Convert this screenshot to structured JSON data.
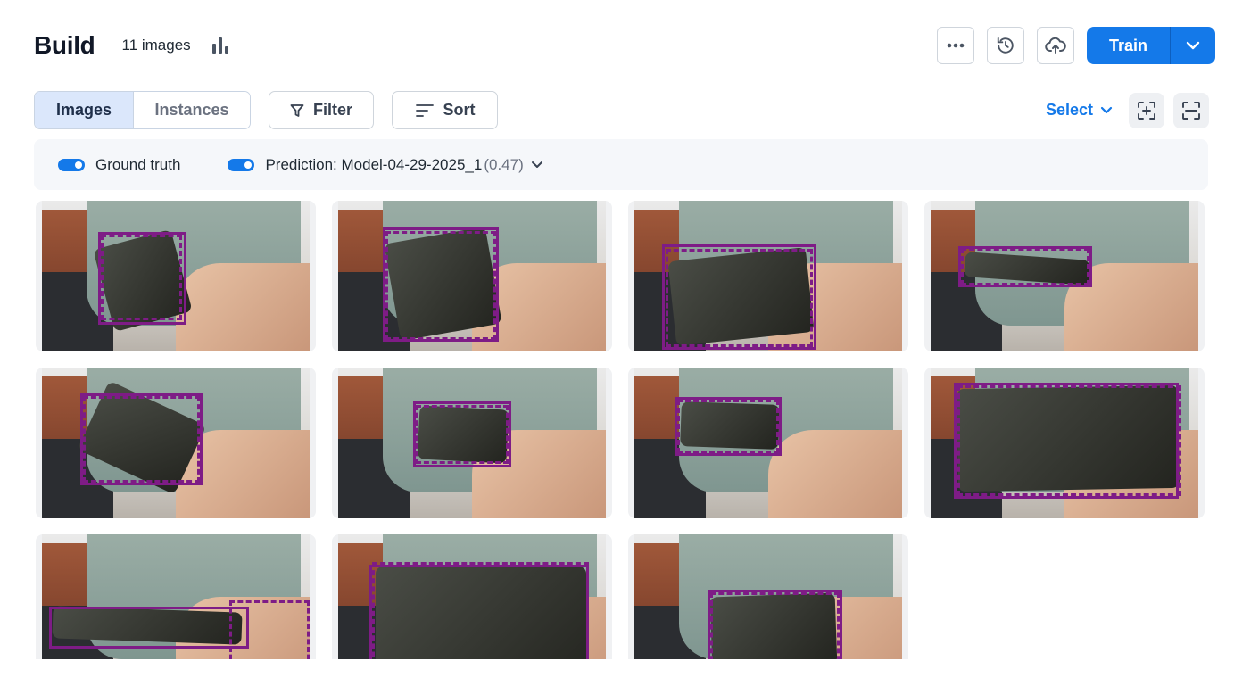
{
  "header": {
    "title": "Build",
    "image_count": "11 images",
    "train_label": "Train"
  },
  "toolbar": {
    "tabs": [
      {
        "label": "Images",
        "active": true
      },
      {
        "label": "Instances",
        "active": false
      }
    ],
    "filter_label": "Filter",
    "sort_label": "Sort",
    "select_label": "Select"
  },
  "filter_bar": {
    "ground_truth_label": "Ground truth",
    "ground_truth_on": true,
    "prediction_label": "Prediction: Model-04-29-2025_1",
    "prediction_score": "(0.47)",
    "prediction_on": true
  },
  "colors": {
    "accent": "#1479e9",
    "box_color": "#7e1c86",
    "active_tab_bg": "#dbe7fb"
  },
  "icons": [
    "stats-icon",
    "more-icon",
    "history-icon",
    "upload-cloud-icon",
    "chevron-down-icon",
    "filter-icon",
    "sort-icon",
    "focus-add-icon",
    "scan-icon"
  ]
}
